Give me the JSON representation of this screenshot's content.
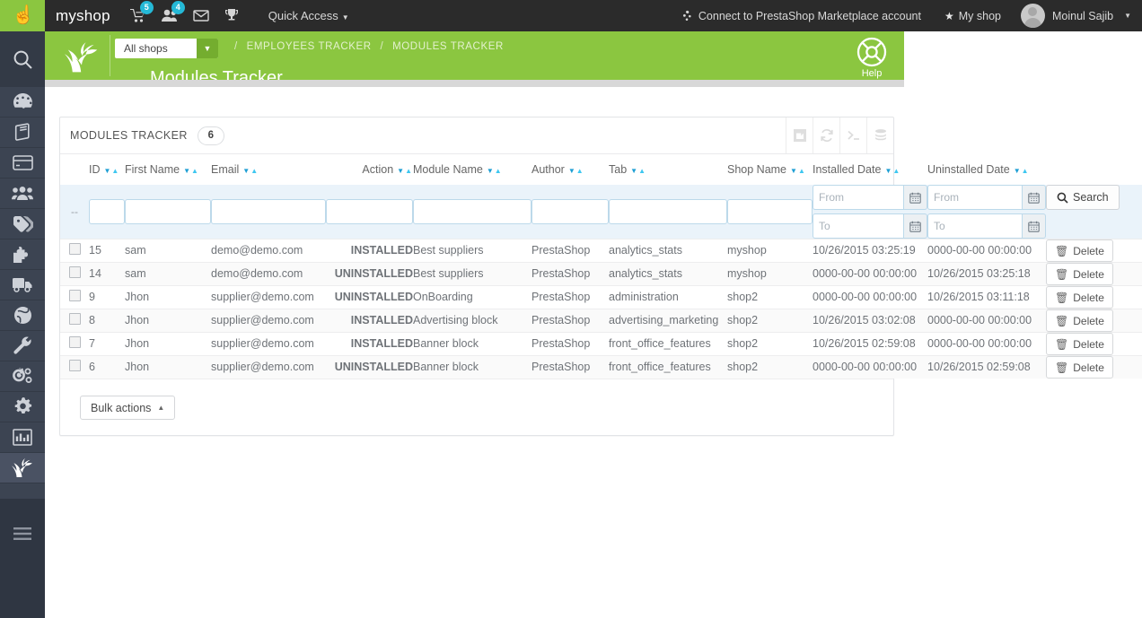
{
  "topbar": {
    "cursor_icon": "hand-pointer-cursor-icon",
    "shop_name": "myshop",
    "icons": [
      {
        "name": "cart-icon",
        "glyph": "🛒",
        "badge": "5"
      },
      {
        "name": "customers-icon",
        "glyph": "👤",
        "badge": "4"
      },
      {
        "name": "envelope-icon",
        "glyph": "✉",
        "badge": ""
      },
      {
        "name": "trophy-icon",
        "glyph": "🏆",
        "badge": ""
      }
    ],
    "quick_access_label": "Quick Access",
    "marketplace_label": "Connect to PrestaShop Marketplace account",
    "my_shop_label": "My shop",
    "employee_name": "Moinul Sajib"
  },
  "header": {
    "shop_selector_value": "All shops",
    "breadcrumb": [
      "EMPLOYEES TRACKER",
      "MODULES TRACKER"
    ],
    "breadcrumb_separator": "/",
    "page_title": "Modules Tracker",
    "help_label": "Help",
    "accent_green": "#8bc640"
  },
  "sidebar": {
    "search_icon": "search-icon",
    "items": [
      {
        "name": "sidebar-item-dashboard",
        "icon": "dashboard-gauge-icon"
      },
      {
        "name": "sidebar-item-catalog",
        "icon": "book-icon"
      },
      {
        "name": "sidebar-item-orders",
        "icon": "credit-card-icon"
      },
      {
        "name": "sidebar-item-customers",
        "icon": "people-group-icon"
      },
      {
        "name": "sidebar-item-price-rules",
        "icon": "price-tags-icon"
      },
      {
        "name": "sidebar-item-modules",
        "icon": "puzzle-piece-icon"
      },
      {
        "name": "sidebar-item-shipping",
        "icon": "truck-icon"
      },
      {
        "name": "sidebar-item-localization",
        "icon": "globe-icon"
      },
      {
        "name": "sidebar-item-preferences",
        "icon": "wrench-icon"
      },
      {
        "name": "sidebar-item-advanced-parameters",
        "icon": "gears-icon"
      },
      {
        "name": "sidebar-item-administration",
        "icon": "gear-icon"
      },
      {
        "name": "sidebar-item-stats",
        "icon": "bar-chart-icon"
      },
      {
        "name": "sidebar-item-tracker",
        "icon": "leaf-icon",
        "active": true
      }
    ],
    "collapse_icon": "hamburger-menu-icon"
  },
  "panel": {
    "title": "MODULES TRACKER",
    "count": "6",
    "tools": [
      {
        "name": "export-button",
        "icon": "export-share-icon"
      },
      {
        "name": "refresh-button",
        "icon": "refresh-icon"
      },
      {
        "name": "console-button",
        "icon": "terminal-prompt-icon"
      },
      {
        "name": "sql-manager-button",
        "icon": "database-stack-icon"
      }
    ]
  },
  "table": {
    "columns": [
      {
        "key": "checkbox",
        "label": "",
        "sortable": false
      },
      {
        "key": "id",
        "label": "ID",
        "sortable": true
      },
      {
        "key": "first_name",
        "label": "First Name",
        "sortable": true
      },
      {
        "key": "email",
        "label": "Email",
        "sortable": true
      },
      {
        "key": "action",
        "label": "Action",
        "sortable": true
      },
      {
        "key": "module_name",
        "label": "Module Name",
        "sortable": true
      },
      {
        "key": "author",
        "label": "Author",
        "sortable": true
      },
      {
        "key": "tab",
        "label": "Tab",
        "sortable": true
      },
      {
        "key": "shop_name",
        "label": "Shop Name",
        "sortable": true
      },
      {
        "key": "installed_date",
        "label": "Installed Date",
        "sortable": true
      },
      {
        "key": "uninstalled_date",
        "label": "Uninstalled Date",
        "sortable": true
      },
      {
        "key": "actions",
        "label": "",
        "sortable": false
      }
    ],
    "filters": {
      "checkbox_dash": "--",
      "id": "",
      "first_name": "",
      "email": "",
      "action": "",
      "module_name": "",
      "author": "",
      "tab": "",
      "shop_name": "",
      "installed_from_placeholder": "From",
      "installed_to_placeholder": "To",
      "uninstalled_from_placeholder": "From",
      "uninstalled_to_placeholder": "To",
      "installed_from": "",
      "installed_to": "",
      "uninstalled_from": "",
      "uninstalled_to": "",
      "search_label": "Search",
      "calendar_icon": "calendar-icon",
      "search_icon": "search-icon"
    },
    "rows": [
      {
        "id": "15",
        "first_name": "sam",
        "email": "demo@demo.com",
        "action": "INSTALLED",
        "module_name": "Best suppliers",
        "author": "PrestaShop",
        "tab": "analytics_stats",
        "shop_name": "myshop",
        "installed_date": "10/26/2015 03:25:19",
        "uninstalled_date": "0000-00-00 00:00:00",
        "delete_label": "Delete"
      },
      {
        "id": "14",
        "first_name": "sam",
        "email": "demo@demo.com",
        "action": "UNINSTALLED",
        "module_name": "Best suppliers",
        "author": "PrestaShop",
        "tab": "analytics_stats",
        "shop_name": "myshop",
        "installed_date": "0000-00-00 00:00:00",
        "uninstalled_date": "10/26/2015 03:25:18",
        "delete_label": "Delete"
      },
      {
        "id": "9",
        "first_name": "Jhon",
        "email": "supplier@demo.com",
        "action": "UNINSTALLED",
        "module_name": "OnBoarding",
        "author": "PrestaShop",
        "tab": "administration",
        "shop_name": "shop2",
        "installed_date": "0000-00-00 00:00:00",
        "uninstalled_date": "10/26/2015 03:11:18",
        "delete_label": "Delete"
      },
      {
        "id": "8",
        "first_name": "Jhon",
        "email": "supplier@demo.com",
        "action": "INSTALLED",
        "module_name": "Advertising block",
        "author": "PrestaShop",
        "tab": "advertising_marketing",
        "shop_name": "shop2",
        "installed_date": "10/26/2015 03:02:08",
        "uninstalled_date": "0000-00-00 00:00:00",
        "delete_label": "Delete"
      },
      {
        "id": "7",
        "first_name": "Jhon",
        "email": "supplier@demo.com",
        "action": "INSTALLED",
        "module_name": "Banner block",
        "author": "PrestaShop",
        "tab": "front_office_features",
        "shop_name": "shop2",
        "installed_date": "10/26/2015 02:59:08",
        "uninstalled_date": "0000-00-00 00:00:00",
        "delete_label": "Delete"
      },
      {
        "id": "6",
        "first_name": "Jhon",
        "email": "supplier@demo.com",
        "action": "UNINSTALLED",
        "module_name": "Banner block",
        "author": "PrestaShop",
        "tab": "front_office_features",
        "shop_name": "shop2",
        "installed_date": "0000-00-00 00:00:00",
        "uninstalled_date": "10/26/2015 02:59:08",
        "delete_label": "Delete"
      }
    ]
  },
  "footer": {
    "bulk_actions_label": "Bulk actions"
  },
  "colors": {
    "brand_green": "#8bc640",
    "status_green": "#108a3c",
    "sort_blue": "#27b0e6",
    "filter_row_bg": "#eaf3fa",
    "sidebar_bg": "#3c4452",
    "topbar_bg": "#2b2b2b",
    "badge_blue": "#25b9d7"
  }
}
